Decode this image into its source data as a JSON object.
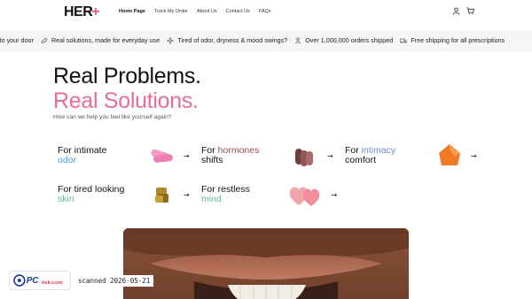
{
  "brand": {
    "logo_text": "HER",
    "logo_accent": "+"
  },
  "nav": {
    "items": [
      "Home Page",
      "Track My Order",
      "About Us",
      "Contact Us",
      "FAQs"
    ],
    "active": "Home Page"
  },
  "header_icons": [
    "account-icon",
    "cart-icon"
  ],
  "announcements": [
    {
      "icon": "truck-icon",
      "text": "y to your door"
    },
    {
      "icon": "pill-icon",
      "text": "Real solutions, made for everyday use"
    },
    {
      "icon": "sparkle-icon",
      "text": "Tired of odor, dryness & mood swings?"
    },
    {
      "icon": "person-icon",
      "text": "Over 1,000,000 orders shipped"
    },
    {
      "icon": "truck-icon",
      "text": "Free shipping for all prescriptions"
    }
  ],
  "hero": {
    "line1": "Real Problems.",
    "line2": "Real Solutions.",
    "subtitle": "How can we help you feel like yourself again?"
  },
  "categories": [
    {
      "prefix": "For intimate",
      "highlight": "odor",
      "accent": "#4aa3d6",
      "product": "pink-capsule-icon"
    },
    {
      "prefix": "For",
      "highlight_inline": "hormones",
      "suffix": "shifts",
      "accent": "#a04848",
      "product": "brown-capsule-icon"
    },
    {
      "prefix": "For",
      "highlight_inline": "intimacy",
      "suffix": "comfort",
      "accent": "#6b8fd6",
      "product": "orange-gummy-icon"
    },
    {
      "prefix": "For tired looking",
      "highlight": "skin",
      "accent": "#5fbf8a",
      "product": "gold-gummy-icon"
    },
    {
      "prefix": "For restless",
      "highlight": "mind",
      "accent": "#5fbf8a",
      "product": "pink-heart-gummy-icon"
    }
  ],
  "watermark": {
    "logo": "PCrisk.com",
    "stamp": "scanned 2026-05-21"
  },
  "colors": {
    "pink": "#e86b9c",
    "marquee_bg": "#f6f6f6",
    "text": "#111111"
  }
}
